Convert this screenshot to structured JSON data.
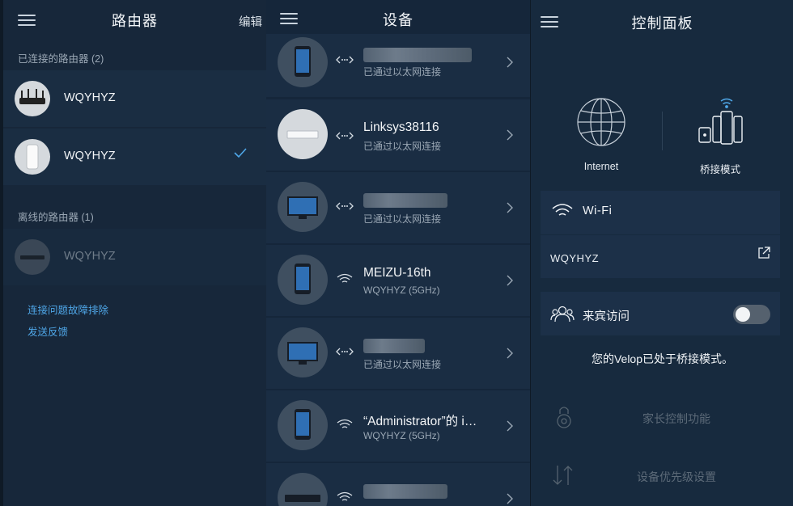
{
  "routers_panel": {
    "title": "路由器",
    "edit_label": "编辑",
    "connected_section": "已连接的路由器 (2)",
    "offline_section": "离线的路由器 (1)",
    "connected": [
      {
        "name": "WQYHYZ",
        "selected": false,
        "device": "router-tri-antenna"
      },
      {
        "name": "WQYHYZ",
        "selected": true,
        "device": "velop-tower"
      }
    ],
    "offline": [
      {
        "name": "WQYHYZ",
        "device": "router-flat"
      }
    ],
    "links": {
      "troubleshoot": "连接问题故障排除",
      "feedback": "发送反馈"
    }
  },
  "devices_panel": {
    "title": "设备",
    "devices": [
      {
        "name": "",
        "sub": "已通过以太网连接",
        "conn": "ethernet",
        "device": "phone",
        "name_blurred": true
      },
      {
        "name": "Linksys38116",
        "sub": "已通过以太网连接",
        "conn": "ethernet",
        "device": "router-white",
        "name_blurred": false
      },
      {
        "name": "",
        "sub": "已通过以太网连接",
        "conn": "ethernet",
        "device": "monitor",
        "name_blurred": true
      },
      {
        "name": "MEIZU-16th",
        "sub": "WQYHYZ (5GHz)",
        "conn": "wifi",
        "device": "phone",
        "name_blurred": false
      },
      {
        "name": "",
        "sub": "已通过以太网连接",
        "conn": "ethernet",
        "device": "monitor",
        "name_blurred": true
      },
      {
        "name": "“Administrator”的 i…",
        "sub": "WQYHYZ (5GHz)",
        "conn": "wifi",
        "device": "phone",
        "name_blurred": false
      },
      {
        "name": "",
        "sub": "",
        "conn": "wifi",
        "device": "set-top-box",
        "name_blurred": true
      }
    ]
  },
  "dashboard_panel": {
    "title": "控制面板",
    "internet_label": "Internet",
    "bridge_label": "桥接模式",
    "wifi_title": "Wi-Fi",
    "ssid": "WQYHYZ",
    "guest_label": "来宾访问",
    "guest_enabled": false,
    "bridge_note": "您的Velop已处于桥接模式。",
    "parental_label": "家长控制功能",
    "priority_label": "设备优先级设置"
  },
  "colors": {
    "accent": "#4fa7e8",
    "bg": "#142334",
    "row": "#1a2d42",
    "muted": "#9aa7b4"
  }
}
